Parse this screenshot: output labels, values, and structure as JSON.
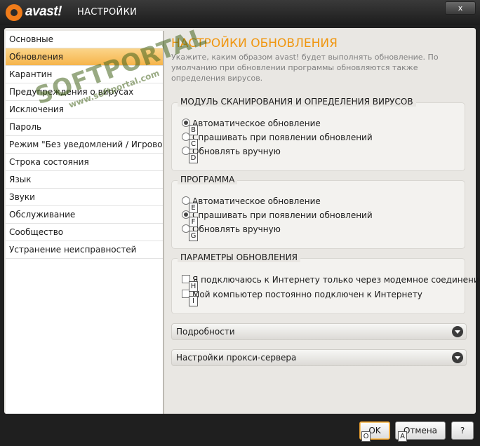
{
  "window": {
    "brand": "avast!",
    "title": "НАСТРОЙКИ",
    "close_label": "x"
  },
  "sidebar": {
    "items": [
      {
        "label": "Основные"
      },
      {
        "label": "Обновления"
      },
      {
        "label": "Карантин"
      },
      {
        "label": "Предупреждения о вирусах"
      },
      {
        "label": "Исключения"
      },
      {
        "label": "Пароль"
      },
      {
        "label": "Режим \"Без уведомлений / Игровой\""
      },
      {
        "label": "Строка состояния"
      },
      {
        "label": "Язык"
      },
      {
        "label": "Звуки"
      },
      {
        "label": "Обслуживание"
      },
      {
        "label": "Сообщество"
      },
      {
        "label": "Устранение неисправностей"
      }
    ],
    "active_index": 1
  },
  "main": {
    "title": "НАСТРОЙКИ ОБНОВЛЕНИЯ",
    "description": "Укажите, каким образом avast! будет выполнять обновление. По умолчанию при обновлении программы обновляются также определения вирусов.",
    "groups": [
      {
        "label": "МОДУЛЬ СКАНИРОВАНИЯ И ОПРЕДЕЛЕНИЯ ВИРУСОВ",
        "options": [
          {
            "label": "Автоматическое обновление",
            "key": "B",
            "checked": true
          },
          {
            "label": "Спрашивать при появлении обновлений",
            "key": "C",
            "checked": false
          },
          {
            "label": "Обновлять вручную",
            "key": "D",
            "checked": false
          }
        ]
      },
      {
        "label": "ПРОГРАММА",
        "options": [
          {
            "label": "Автоматическое обновление",
            "key": "E",
            "checked": false
          },
          {
            "label": "Спрашивать при появлении обновлений",
            "key": "F",
            "checked": true
          },
          {
            "label": "Обновлять вручную",
            "key": "G",
            "checked": false
          }
        ]
      },
      {
        "label": "ПАРАМЕТРЫ ОБНОВЛЕНИЯ",
        "options": [
          {
            "label": "Я подключаюсь к Интернету только через модемное соединение",
            "key": "H",
            "checked": false
          },
          {
            "label": "Мой компьютер постоянно подключен к Интернету",
            "key": "I",
            "checked": false
          }
        ]
      }
    ],
    "expanders": [
      {
        "label": "Подробности"
      },
      {
        "label": "Настройки прокси-сервера"
      }
    ]
  },
  "footer": {
    "ok_label": "OK",
    "ok_key": "O",
    "cancel_label": "Отмена",
    "cancel_key": "A",
    "help_label": "?"
  },
  "watermark": {
    "text": "SOFTPORTAL",
    "url": "www.softportal.com"
  },
  "colors": {
    "accent": "#f0960f",
    "active_item": "#f6b44a",
    "titlebar": "#1c1c1c"
  }
}
